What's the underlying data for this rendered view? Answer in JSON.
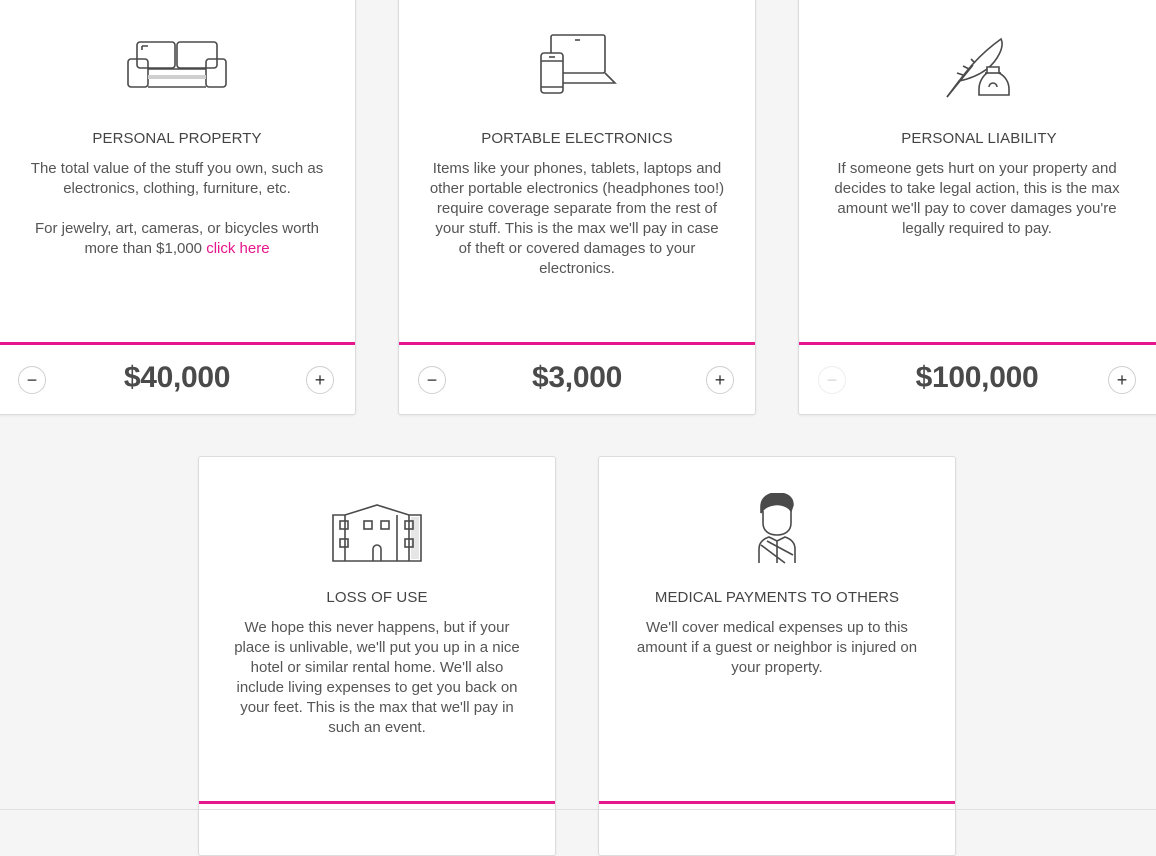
{
  "colors": {
    "accent": "#e6168c",
    "text": "#4a4a4a",
    "background": "#f5f5f5"
  },
  "cards": [
    {
      "icon": "couch-icon",
      "title": "PERSONAL PROPERTY",
      "description": "The total value of the stuff you own, such as electronics, clothing, furniture, etc.",
      "description_2": "For jewelry, art, cameras, or bicycles worth more than $1,000",
      "link": "click here",
      "amount": "$40,000",
      "minus": "−",
      "plus": "+"
    },
    {
      "icon": "laptop-phone-icon",
      "title": "PORTABLE ELECTRONICS",
      "description": "Items like your phones, tablets, laptops and other portable electronics (headphones too!) require coverage separate from the rest of your stuff. This is the max we'll pay in case of theft or covered damages to your electronics.",
      "amount": "$3,000",
      "minus": "−",
      "plus": "+"
    },
    {
      "icon": "quill-ink-icon",
      "title": "PERSONAL LIABILITY",
      "description": "If someone gets hurt on your property and decides to take legal action, this is the max amount we'll pay to cover damages you're legally required to pay.",
      "amount": "$100,000",
      "minus": "−",
      "plus": "+"
    },
    {
      "icon": "building-icon",
      "title": "LOSS OF USE",
      "description": "We hope this never happens, but if your place is unlivable, we'll put you up in a nice hotel or similar rental home. We'll also include living expenses to get you back on your feet. This is the max that we'll pay in such an event."
    },
    {
      "icon": "injured-person-icon",
      "title": "MEDICAL PAYMENTS TO OTHERS",
      "description": "We'll cover medical expenses up to this amount if a guest or neighbor is injured on your property."
    }
  ]
}
